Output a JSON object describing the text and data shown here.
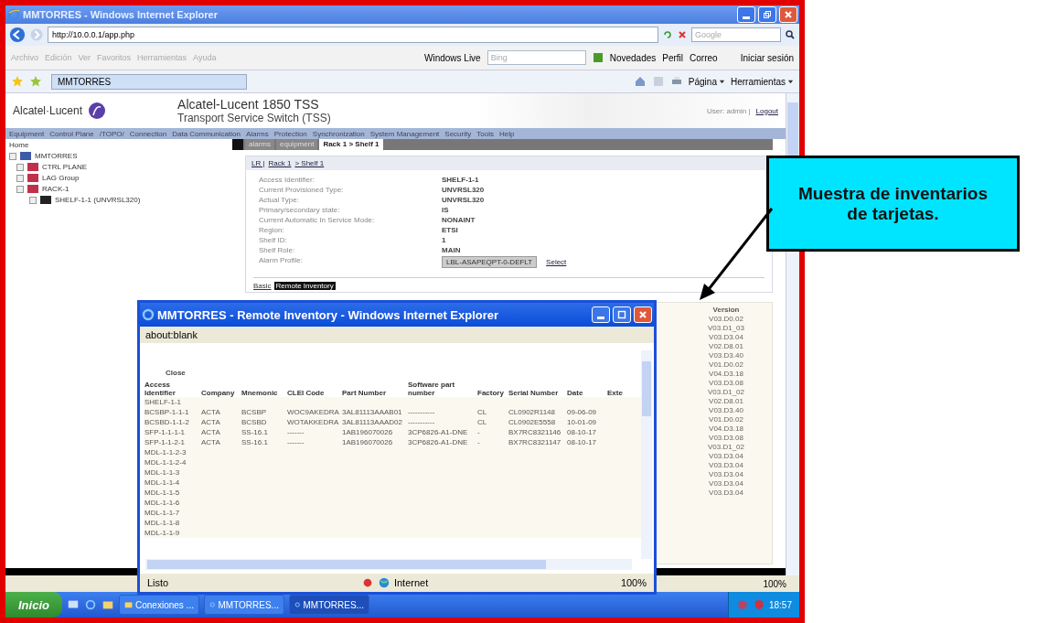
{
  "main_window": {
    "title": "MMTORRES - Windows Internet Explorer",
    "address": "http://10.0.0.1/app.php",
    "search_placeholder": "Google",
    "menu": [
      "Archivo",
      "Edición",
      "Ver",
      "Favoritos",
      "Herramientas",
      "Ayuda"
    ],
    "live_label": "Windows Live",
    "live_placeholder": "Bing",
    "live_links": [
      "Novedades",
      "Perfil",
      "Correo"
    ],
    "sign_in": "Iniciar sesión",
    "favorite_tab": "MMTORRES",
    "commands": [
      "Página",
      "Herramientas"
    ],
    "status_zoom": "100%"
  },
  "page": {
    "brand": "Alcatel·Lucent",
    "product_title": "Alcatel-Lucent 1850 TSS",
    "product_subtitle": "Transport Service Switch (TSS)",
    "user_label": "User: admin |",
    "logout": "Logout",
    "nav": [
      "Equipment",
      "Control Plane",
      "/TOPO/",
      "Connection",
      "Data Communication",
      "Alarms",
      "Protection",
      "Synchronization",
      "System Management",
      "Security",
      "Tools",
      "Help"
    ],
    "tree_title": "Home",
    "tree": [
      {
        "label": "MMTORRES",
        "children": [
          {
            "label": "CTRL PLANE"
          },
          {
            "label": "LAG Group"
          },
          {
            "label": "RACK-1",
            "children": [
              {
                "label": "SHELF-1-1 (UNVRSL320)"
              }
            ]
          }
        ]
      }
    ],
    "tabs": [
      {
        "label": "alarms",
        "selected": false
      },
      {
        "label": "equipment",
        "selected": false
      },
      {
        "label": "Rack 1 > Shelf 1",
        "selected": true
      }
    ],
    "breadcrumb": [
      {
        "label": "LR |"
      },
      {
        "label": "Rack 1"
      },
      {
        "label": "> Shelf 1"
      }
    ],
    "fields": [
      {
        "label": "Access Identifier:",
        "value": "SHELF-1-1"
      },
      {
        "label": "Current Provisioned Type:",
        "value": "UNVRSL320"
      },
      {
        "label": "Actual Type:",
        "value": "UNVRSL320"
      },
      {
        "label": "Primary/secondary state:",
        "value": "IS"
      },
      {
        "label": "Current Automatic In Service Mode:",
        "value": "NONAINT"
      },
      {
        "label": "Region:",
        "value": "ETSI"
      },
      {
        "label": "Shelf ID:",
        "value": "1"
      },
      {
        "label": "Shelf Role:",
        "value": "MAIN"
      },
      {
        "label": "Alarm Profile:",
        "value": "LBL-ASAPEQPT-0-DEFLT",
        "kind": "field"
      }
    ],
    "select_link": "Select",
    "detail_tabs": [
      {
        "label": "Basic",
        "selected": false
      },
      {
        "label": "Remote Inventory",
        "selected": true
      }
    ],
    "version_header": "Version",
    "versions": [
      "V03.D0.02",
      "V03.D1_03",
      "V03.D3.04",
      "V02.D8.01",
      "V03.D3.40",
      "V01.D0.02",
      "V04.D3.18",
      "V03.D3.08",
      "V03.D1_02",
      "V02.D8.01",
      "V03.D3.40",
      "V01.D0.02",
      "V04.D3.18",
      "V03.D3.08",
      "V03.D1_02",
      "V03.D3.04",
      "V03.D3.04",
      "V03.D3.04",
      "V03.D3.04",
      "V03.D3.04"
    ]
  },
  "popup": {
    "title": "MMTORRES - Remote Inventory - Windows Internet Explorer",
    "address": "about:blank",
    "close_link": "Close",
    "columns": [
      "Access Identifier",
      "Company",
      "Mnemonic",
      "CLEI Code",
      "Part Number",
      "Software part number",
      "Factory",
      "Serial Number",
      "Date",
      "Exte"
    ],
    "rows": [
      [
        "SHELF-1-1"
      ],
      [
        "BCSBP-1-1-1",
        "ACTA",
        "BCSBP",
        "WOC9AKEDRA",
        "3AL81113AAAB01",
        "-----------",
        "CL",
        "CL0902R1148",
        "09-06-09"
      ],
      [
        "BCSBD-1-1-2",
        "ACTA",
        "BCSBD",
        "WOTAKKEDRA",
        "3AL81113AAAD02",
        "-----------",
        "CL",
        "CL0902E5558",
        "10-01-09"
      ],
      [
        "SFP-1-1-1-1",
        "ACTA",
        "SS-16.1",
        "-------",
        "1AB196070026",
        "3CP6826-A1-DNE",
        "-",
        "BX7RC8321146",
        "08-10-17"
      ],
      [
        "SFP-1-1-2-1",
        "ACTA",
        "SS-16.1",
        "-------",
        "1AB196070026",
        "3CP6826-A1-DNE",
        "-",
        "BX7RC8321147",
        "08-10-17"
      ],
      [
        "MDL-1-1-2-3"
      ],
      [
        "MDL-1-1-2-4"
      ],
      [
        "MDL-1-1-3"
      ],
      [
        "MDL-1-1-4"
      ],
      [
        "MDL-1-1-5"
      ],
      [
        "MDL-1-1-6"
      ],
      [
        "MDL-1-1-7"
      ],
      [
        "MDL-1-1-8"
      ],
      [
        "MDL-1-1-9"
      ]
    ],
    "status": "Listo",
    "zone": "Internet",
    "zoom": "100%"
  },
  "taskbar": {
    "start": "Inicio",
    "tasks": [
      {
        "label": "Conexiones ...",
        "kind": "folder",
        "selected": false
      },
      {
        "label": "MMTORRES...",
        "kind": "browser",
        "selected": false
      },
      {
        "label": "MMTORRES...",
        "kind": "browser",
        "selected": true
      }
    ],
    "clock": "18:57"
  },
  "callout": "Muestra de inventarios de tarjetas."
}
